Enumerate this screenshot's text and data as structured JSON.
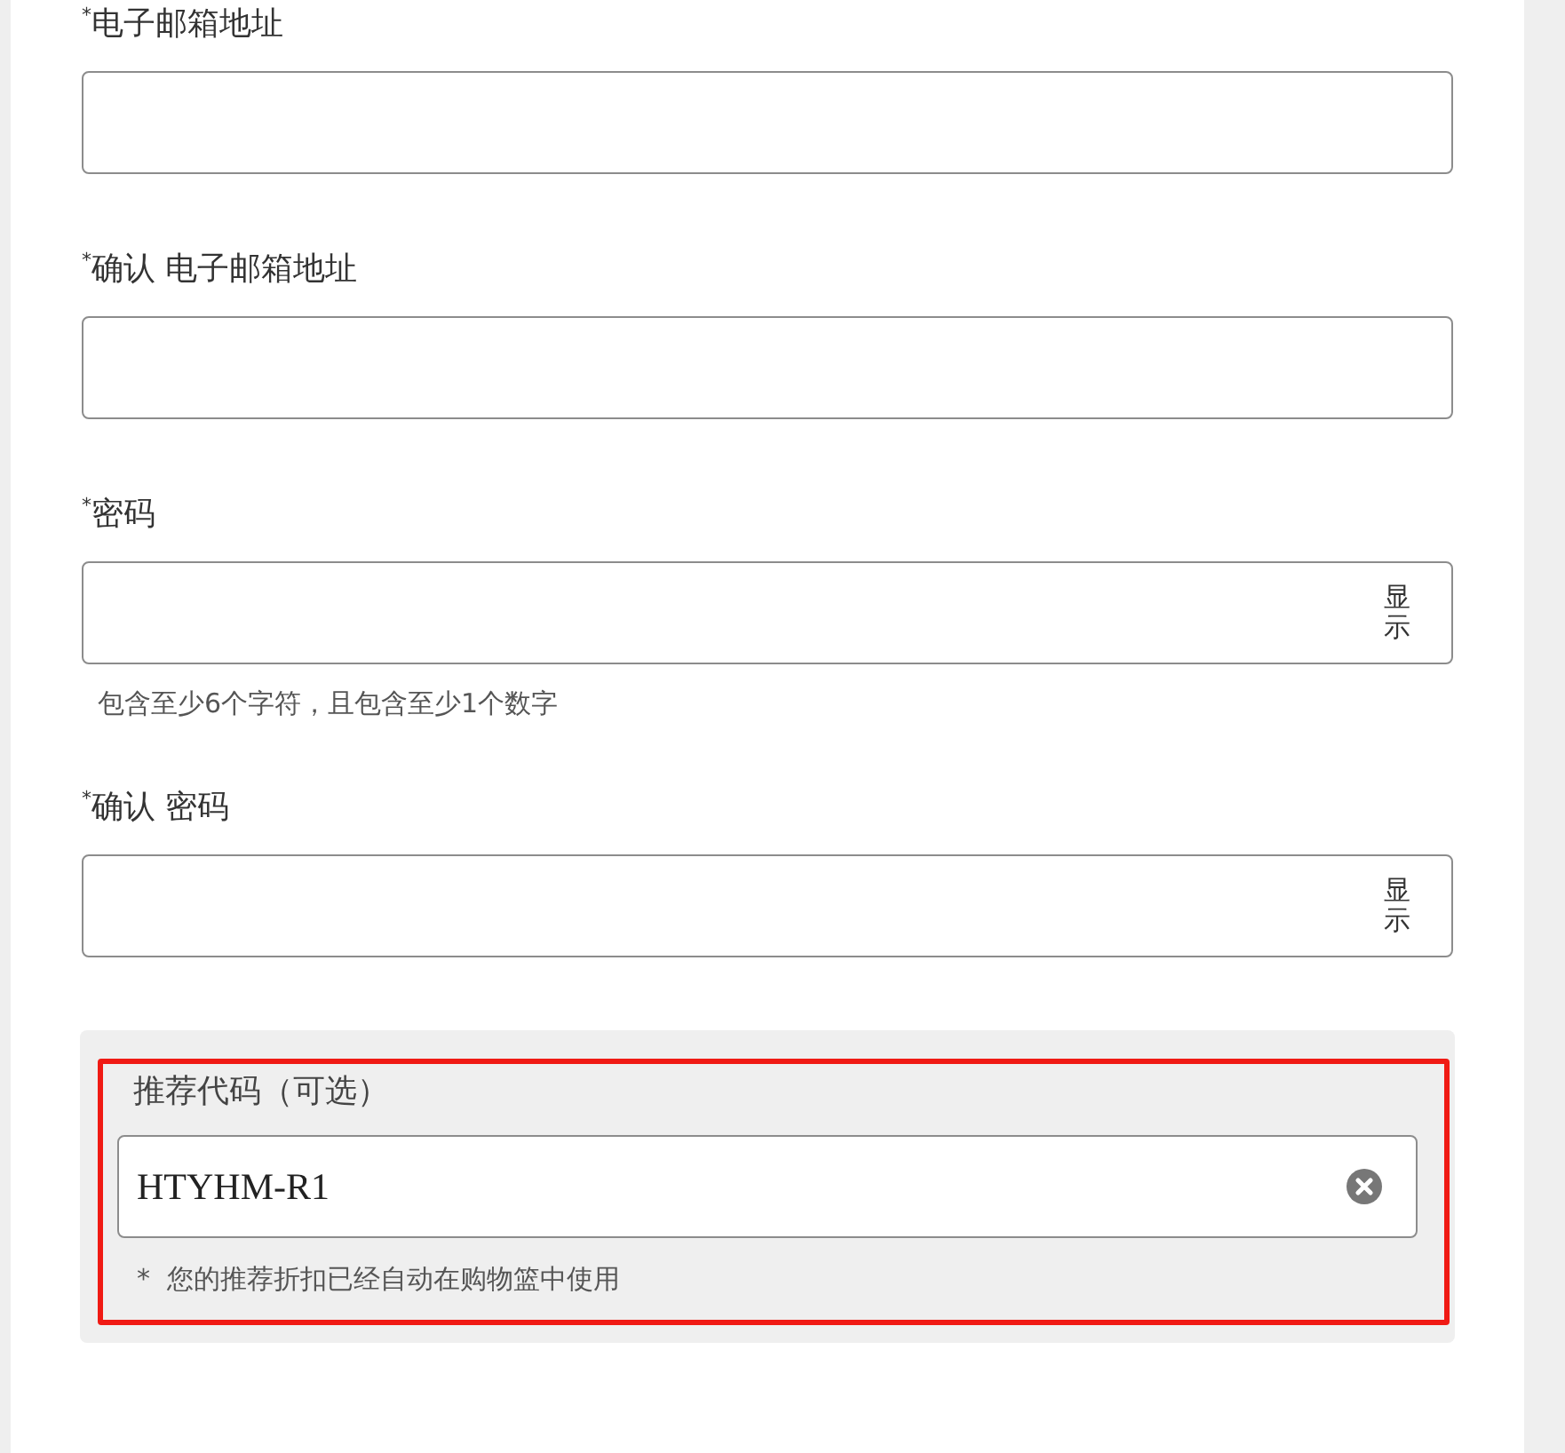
{
  "fields": [
    {
      "label": "$^{*}$电子邮箱地址",
      "kind": "text"
    },
    {
      "label": "$^{*}$确认 电子邮箱地址",
      "kind": "text"
    },
    {
      "label": "$^{*}$密码",
      "kind": "password",
      "toggle": "显示",
      "hint": "包含至少6个字符，且包含至少1个数字"
    },
    {
      "label": "$^{*}$确认 密码",
      "kind": "password",
      "toggle": "显示"
    }
  ],
  "referral": {
    "label": "推荐代码（可选）",
    "value": "HTYHM-R1",
    "note": "*  您的推荐折扣已经自动在购物篮中使用",
    "highlighted": true
  }
}
